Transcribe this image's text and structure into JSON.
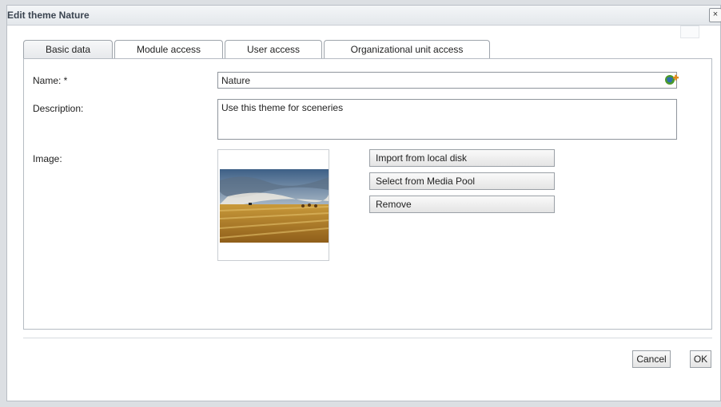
{
  "dialog": {
    "title": "Edit theme Nature",
    "close_glyph": "×"
  },
  "tabs": [
    {
      "label": "Basic data",
      "active": true
    },
    {
      "label": "Module access",
      "active": false
    },
    {
      "label": "User access",
      "active": false
    },
    {
      "label": "Organizational unit access",
      "active": false
    }
  ],
  "form": {
    "name_label": "Name: *",
    "name_value": "Nature",
    "description_label": "Description:",
    "description_value": "Use this theme for sceneries",
    "image_label": "Image:"
  },
  "image_buttons": {
    "import": "Import from local disk",
    "media_pool": "Select from Media Pool",
    "remove": "Remove"
  },
  "footer": {
    "cancel": "Cancel",
    "ok": "OK"
  },
  "icons": {
    "add_translation": "add-translation-icon",
    "close": "close-icon"
  },
  "colors": {
    "tab_border": "#9ea4ab",
    "panel_border": "#b6bcc3",
    "title_text": "#3a4450"
  }
}
